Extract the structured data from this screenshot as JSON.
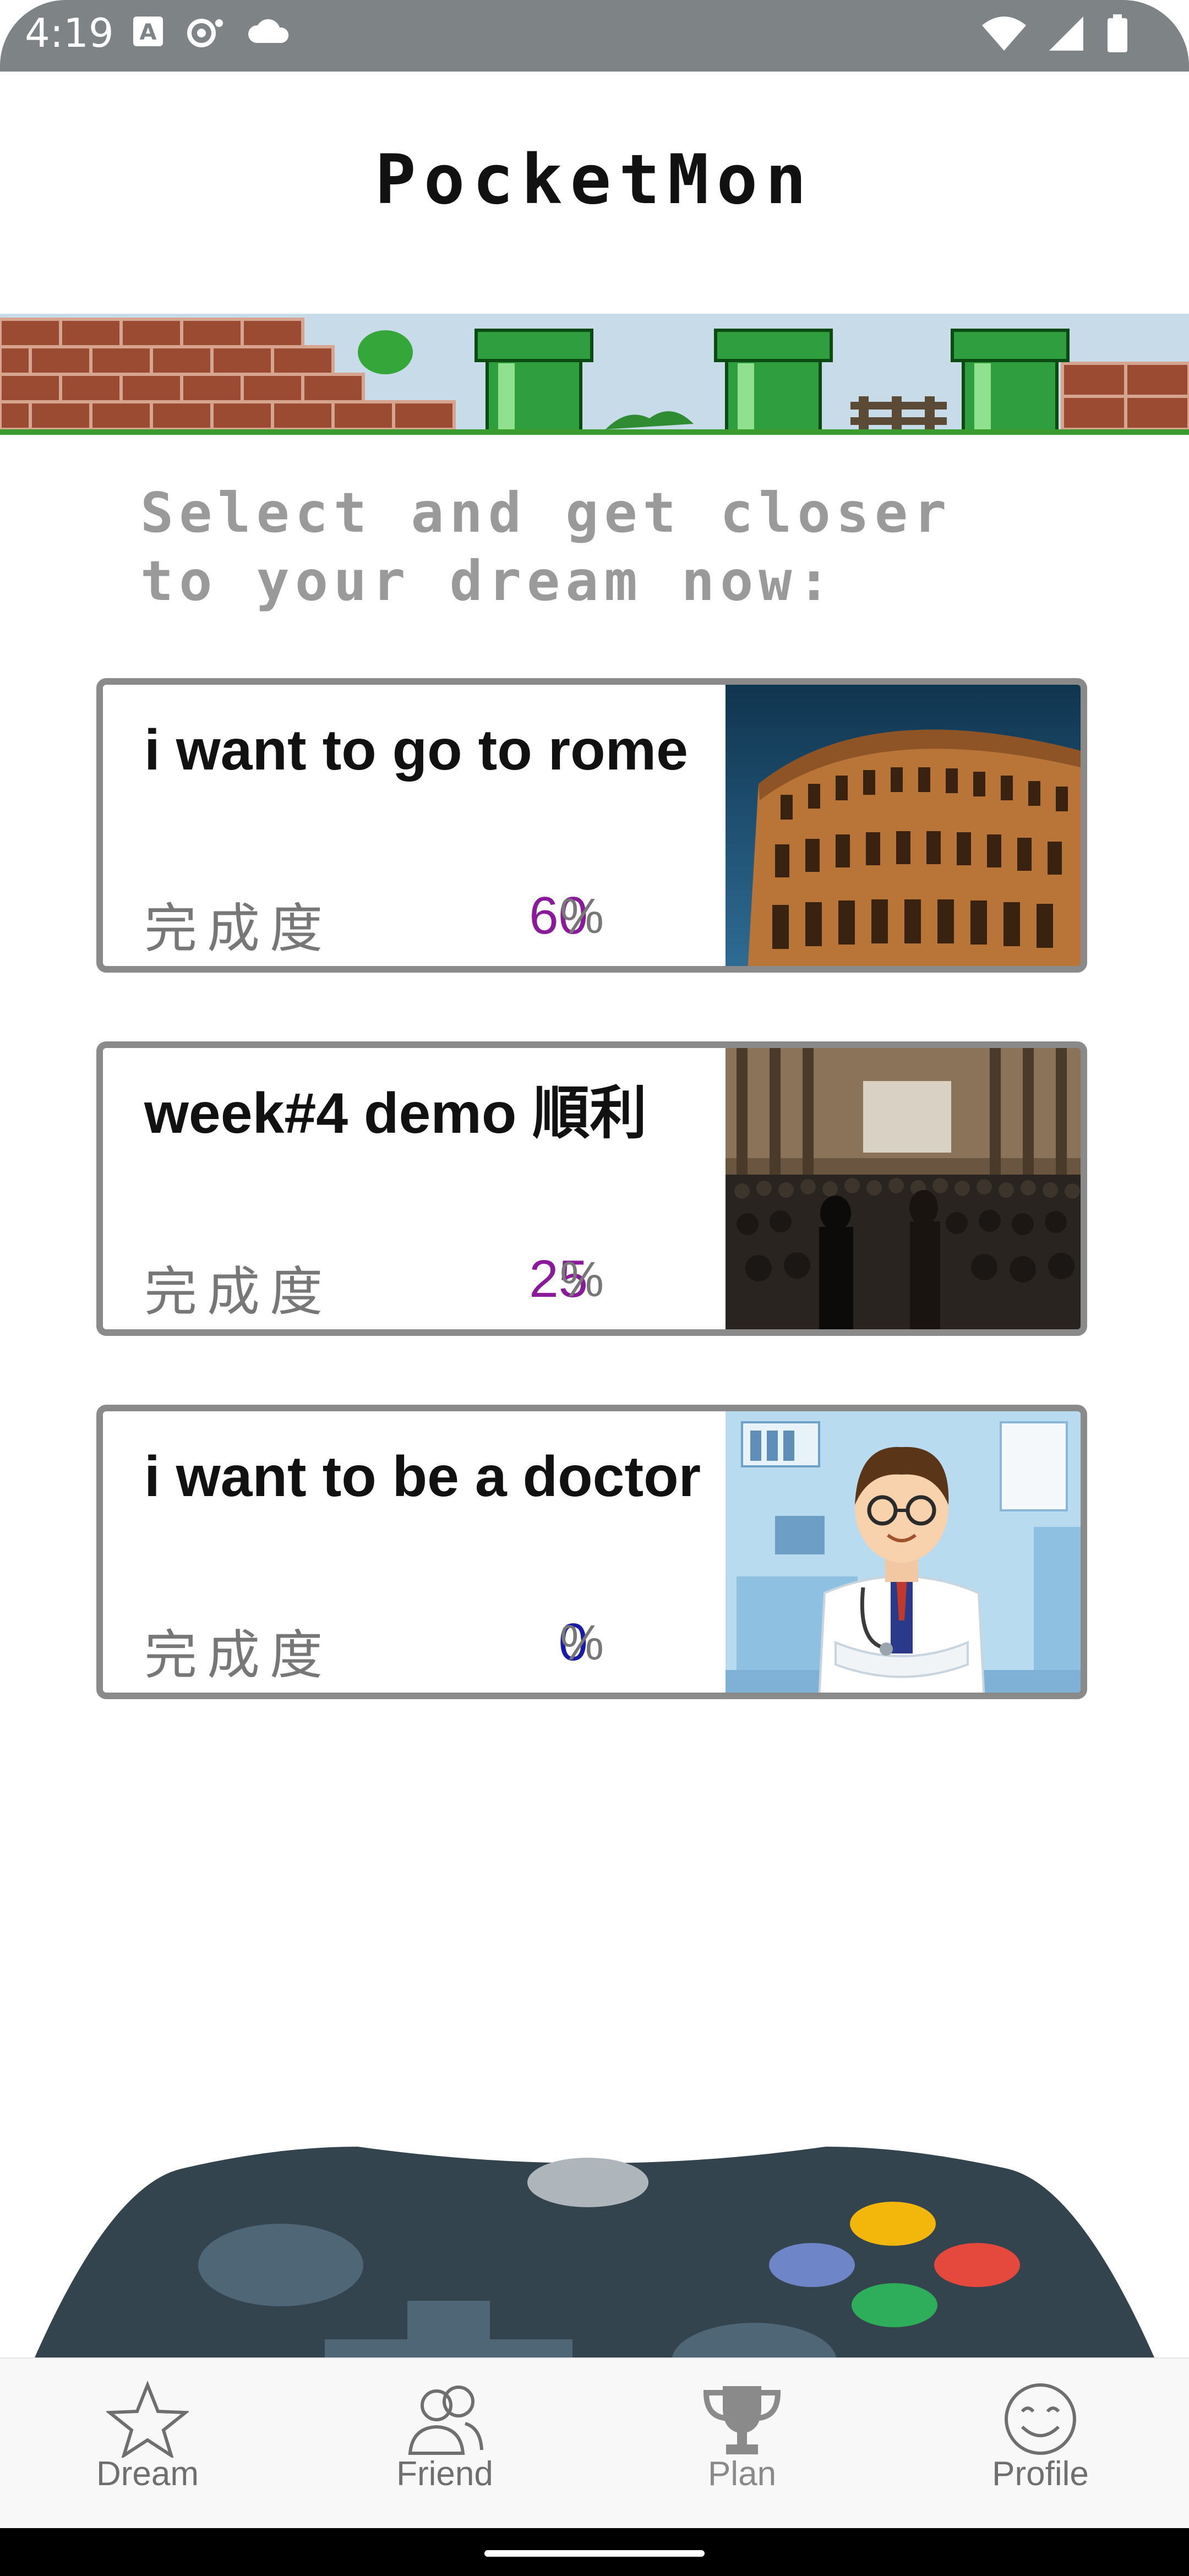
{
  "status_bar": {
    "time": "4:19",
    "left_icons": [
      "keyboard-a-icon",
      "signal-hotspot-icon",
      "cloud-icon"
    ],
    "right_icons": [
      "wifi-icon",
      "cellular-icon",
      "battery-icon"
    ]
  },
  "app": {
    "title": "PocketMon"
  },
  "banner": {
    "icon": "mario-pipes-banner"
  },
  "prompt": {
    "text": "Select and get closer\nto your dream now:"
  },
  "dreams": [
    {
      "title": "i want to go to rome",
      "progress_label": "完成度",
      "progress_value": "60",
      "unit": "%",
      "value_color": "#8b1a9b",
      "image": "colosseum-photo"
    },
    {
      "title": "week#4  demo 順利",
      "progress_label": "完成度",
      "progress_value": "25",
      "unit": "%",
      "value_color": "#8b1a9b",
      "image": "auditorium-photo"
    },
    {
      "title": "i want to be a doctor",
      "progress_label": "完成度",
      "progress_value": "0",
      "unit": "%",
      "value_color": "#1a1aa8",
      "image": "doctor-illustration"
    }
  ],
  "nav": {
    "items": [
      {
        "label": "Dream",
        "icon": "star-icon"
      },
      {
        "label": "Friend",
        "icon": "friends-icon"
      },
      {
        "label": "Plan",
        "icon": "trophy-icon"
      },
      {
        "label": "Profile",
        "icon": "smiley-icon"
      }
    ]
  },
  "colors": {
    "status_bar": "#7e8386",
    "card_border": "#8a8a8a",
    "controller": "#34444f"
  }
}
